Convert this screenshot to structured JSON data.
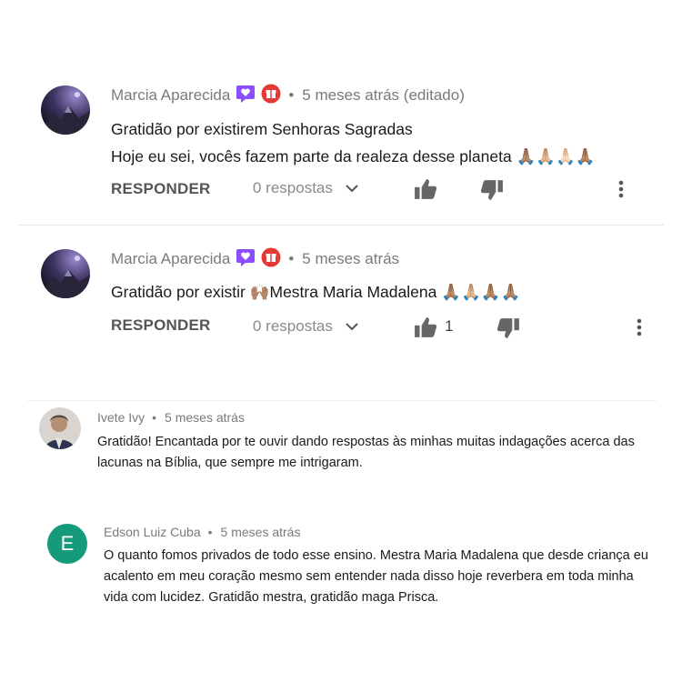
{
  "comments": [
    {
      "author": "Marcia Aparecida",
      "time": "5 meses atrás (editado)",
      "line1": "Gratidão por existirem Senhoras Sagradas",
      "line2": "Hoje eu sei, vocês fazem parte da realeza desse planeta 🙏🏽🙏🏼🙏🏻🙏🏽",
      "reply_label": "RESPONDER",
      "replies_label": "0 respostas",
      "like_count": ""
    },
    {
      "author": "Marcia Aparecida",
      "time": "5 meses atrás",
      "line1": "Gratidão por existir 🙌🏽Mestra Maria Madalena 🙏🏽🙏🏼🙏🏽🙏🏽",
      "reply_label": "RESPONDER",
      "replies_label": "0 respostas",
      "like_count": "1"
    },
    {
      "author": "Ivete Ivy",
      "time": "5 meses atrás",
      "text": "Gratidão! Encantada por te ouvir dando respostas às minhas muitas indagações acerca das lacunas na Bíblia, que sempre me intrigaram."
    },
    {
      "author": "Edson Luiz Cuba",
      "time": "5 meses atrás",
      "avatar_letter": "E",
      "text": "O quanto fomos privados de todo esse ensino. Mestra Maria Madalena que desde criança eu acalento em meu coração mesmo sem entender nada disso hoje reverbera em toda minha vida com lucidez. Gratidão mestra, gratidão maga Prisca."
    }
  ],
  "colors": {
    "purple_badge": "#8a4dff",
    "red_badge": "#e53935",
    "letter_avatar": "#169a7c"
  },
  "icons": [
    "heart-badge-icon",
    "gift-badge-icon",
    "thumbs-up-icon",
    "thumbs-down-icon",
    "more-vert-icon",
    "chevron-down-icon"
  ]
}
